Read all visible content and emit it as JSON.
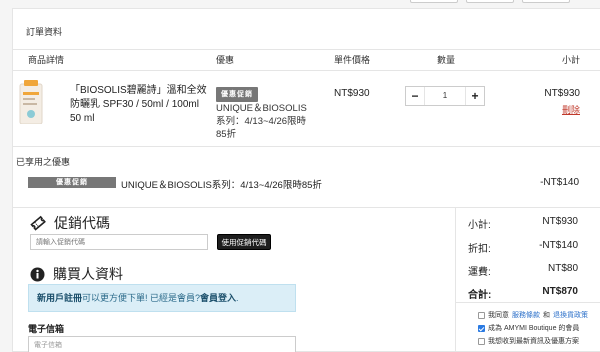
{
  "order": {
    "section_title": "訂單資料",
    "headers": {
      "product": "商品詳情",
      "promo": "優惠",
      "unit_price": "單件價格",
      "qty": "數量",
      "subtotal": "小計"
    },
    "item": {
      "name_line1": "「BIOSOLIS碧麗詩」溫和全效",
      "name_line2": "防曬乳 SPF30 / 50ml / 100ml",
      "variant": "50 ml",
      "promo_badge": "優惠促銷",
      "promo_line1": "UNIQUE＆BIOSOLIS",
      "promo_line2": "系列：4/13~4/26限時",
      "promo_line3": "85折",
      "unit_price": "NT$930",
      "qty_minus": "−",
      "qty_value": "1",
      "qty_plus": "+",
      "subtotal": "NT$930",
      "delete": "刪除"
    },
    "applied": {
      "title": "已享用之優惠",
      "badge": "優惠促銷",
      "description": "UNIQUE＆BIOSOLIS系列：4/13~4/26限時85折",
      "amount": "-NT$140"
    }
  },
  "coupon": {
    "title": "促銷代碼",
    "placeholder": "請輸入促銷代碼",
    "button": "使用促銷代碼"
  },
  "buyer": {
    "title": "購買人資料",
    "notice_lead": "新用戶註冊",
    "notice_mid": "可以更方便下單! 已經是會員?",
    "notice_login": "會員登入",
    "notice_end": ".",
    "email_label": "電子信箱",
    "email_placeholder": "電子信箱"
  },
  "summary": {
    "subtotal_label": "小計:",
    "subtotal": "NT$930",
    "discount_label": "折扣:",
    "discount": "-NT$140",
    "shipping_label": "運費:",
    "shipping": "NT$80",
    "total_label": "合計:",
    "total": "NT$870"
  },
  "agreements": {
    "terms_pre": "我同意",
    "terms_link1": "服務條款",
    "terms_and": "和",
    "terms_link2": "退換貨政策",
    "member": "成為 AMYMI Boutique 的會員",
    "newsletter": "我想收到最新資訊及優惠方案"
  },
  "colors": {
    "accent_link": "#2a6fc9",
    "delete": "#c0392b",
    "notice_bg": "#dbeef7",
    "badge": "#777777"
  }
}
